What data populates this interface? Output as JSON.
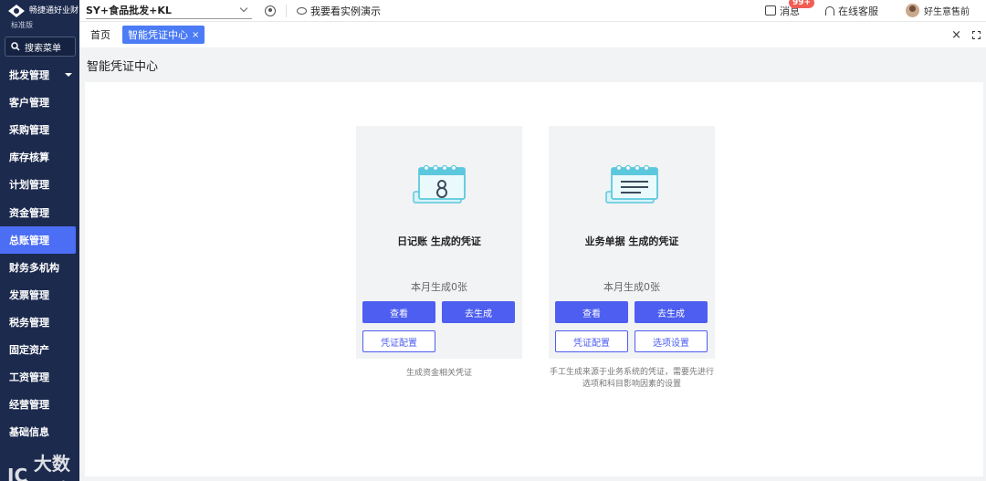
{
  "brand": {
    "name": "畅捷通好业财",
    "edition": "标准版"
  },
  "sidebar": {
    "search_label": "搜索菜单",
    "items": [
      {
        "label": "批发管理"
      },
      {
        "label": "客户管理"
      },
      {
        "label": "采购管理"
      },
      {
        "label": "库存核算"
      },
      {
        "label": "计划管理"
      },
      {
        "label": "资金管理"
      },
      {
        "label": "总账管理"
      },
      {
        "label": "财务多机构"
      },
      {
        "label": "发票管理"
      },
      {
        "label": "税务管理"
      },
      {
        "label": "固定资产"
      },
      {
        "label": "工资管理"
      },
      {
        "label": "经营管理"
      },
      {
        "label": "基础信息"
      }
    ],
    "active_item": "总账管理",
    "watermark": "大数跨境"
  },
  "topbar": {
    "company": "SY+食品批发+KL",
    "demo_label": "我要看实例演示",
    "messages_label": "消息",
    "messages_badge": "99+",
    "service_label": "在线客服",
    "user_name": "好生意售前"
  },
  "tabs": {
    "home": "首页",
    "active": "智能凭证中心",
    "active_close": "×",
    "close_all": "×"
  },
  "page": {
    "title": "智能凭证中心"
  },
  "cards": {
    "left": {
      "title": "日记账 生成的凭证",
      "count": "本月生成0张",
      "view_label": "查看",
      "generate_label": "去生成",
      "config_label": "凭证配置",
      "description": "生成资金相关凭证"
    },
    "right": {
      "title": "业务单据 生成的凭证",
      "count": "本月生成0张",
      "view_label": "查看",
      "generate_label": "去生成",
      "config_label": "凭证配置",
      "options_label": "选项设置",
      "description_line1": "手工生成来源于业务系统的凭证，需要先进行",
      "description_line2": "选项和科目影响因素的设置"
    }
  },
  "colors": {
    "sidebar_bg": "#1c2a4e",
    "accent": "#4d5ef0",
    "tab_active": "#4b7bf5",
    "badge": "#f25c54",
    "icon_teal": "#5cc8dd"
  }
}
